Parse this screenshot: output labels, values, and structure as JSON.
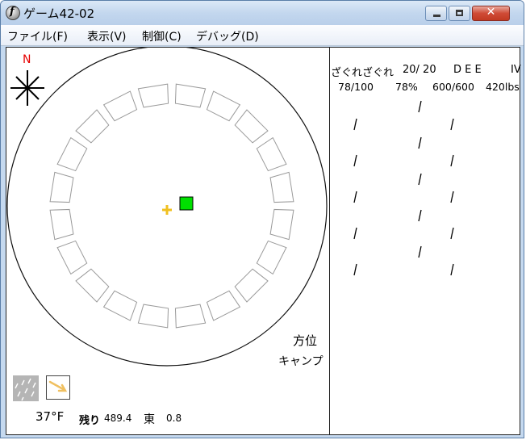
{
  "window": {
    "title": "ゲーム42-02",
    "app_icon": "flash-icon"
  },
  "menu": {
    "items": [
      "ファイル(F)",
      "表示(V)",
      "制御(C)",
      "デバッグ(D)"
    ]
  },
  "map": {
    "compass_label": "N",
    "direction_label": "方位",
    "location_label": "キャンプ",
    "segment_count": 20,
    "colors": {
      "player": "#00e000",
      "target": "#f0c020",
      "compass_n": "#e60000",
      "wind_arrow": "#f0c060"
    }
  },
  "status": {
    "temperature": "37°F",
    "remaining_label": "残り",
    "remaining_value": "489.4",
    "direction_label": "東",
    "direction_value": "0.8",
    "weather_icon": "rain-icon",
    "wind_icon": "wind-arrow-icon"
  },
  "stats": {
    "name": "ざぐれざぐれ",
    "count": "20/ 20",
    "grades": "D E E",
    "roman": "IV",
    "health": "78/100",
    "percent": "78%",
    "stamina": "600/600",
    "weight": "420lbs"
  }
}
